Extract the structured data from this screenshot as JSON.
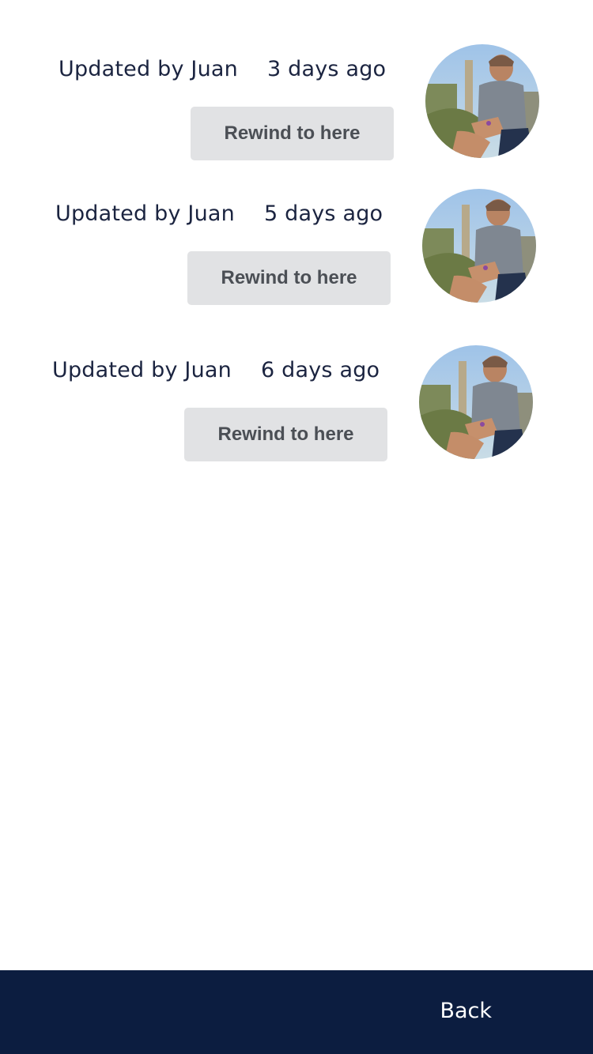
{
  "history": [
    {
      "author": "Updated by Juan",
      "time": "3 days ago",
      "action_label": "Rewind to here"
    },
    {
      "author": "Updated by Juan",
      "time": "5 days ago",
      "action_label": "Rewind to here"
    },
    {
      "author": "Updated by Juan",
      "time": "6 days ago",
      "action_label": "Rewind to here"
    }
  ],
  "footer": {
    "back_label": "Back"
  },
  "colors": {
    "text": "#1b2440",
    "button_bg": "#e1e2e4",
    "button_text": "#4b4f55",
    "footer_bg": "#0c1d40"
  },
  "icons": {
    "avatar": "user-avatar-photo"
  }
}
